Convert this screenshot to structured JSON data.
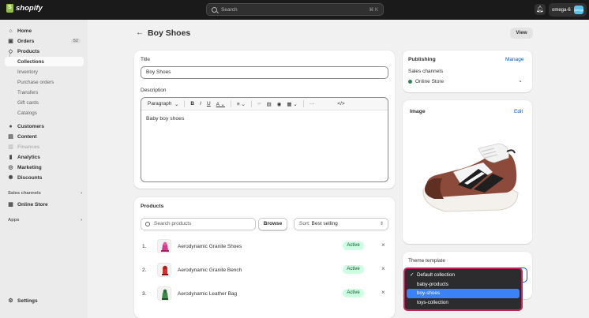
{
  "topbar": {
    "brand": "shopify",
    "search_placeholder": "Search",
    "search_shortcut": "⌘ K",
    "store_name": "omega-6",
    "store_avatar": "omega"
  },
  "sidebar": {
    "items": [
      {
        "label": "Home",
        "icon": "home-icon"
      },
      {
        "label": "Orders",
        "icon": "inbox-icon",
        "badge": "52"
      },
      {
        "label": "Products",
        "icon": "tag-icon"
      }
    ],
    "product_sub": [
      "Collections",
      "Inventory",
      "Purchase orders",
      "Transfers",
      "Gift cards",
      "Catalogs"
    ],
    "items2": [
      {
        "label": "Customers",
        "icon": "person-icon"
      },
      {
        "label": "Content",
        "icon": "content-icon"
      },
      {
        "label": "Finances",
        "icon": "bank-icon",
        "disabled": true
      },
      {
        "label": "Analytics",
        "icon": "chart-icon"
      },
      {
        "label": "Marketing",
        "icon": "target-icon"
      },
      {
        "label": "Discounts",
        "icon": "discount-icon"
      }
    ],
    "sales_channels_heading": "Sales channels",
    "online_store": "Online Store",
    "apps_heading": "Apps",
    "settings": "Settings"
  },
  "page": {
    "title": "Boy Shoes",
    "view_label": "View"
  },
  "details": {
    "title_label": "Title",
    "title_value": "Boy Shoes",
    "description_label": "Description",
    "paragraph_label": "Paragraph",
    "description_text": "Baby boy shoes"
  },
  "products": {
    "heading": "Products",
    "search_placeholder": "Search products",
    "browse_label": "Browse",
    "sort_prefix": "Sort:",
    "sort_value": "Best selling",
    "rows": [
      {
        "num": "1.",
        "name": "Aerodynamic Granite Shoes",
        "status": "Active"
      },
      {
        "num": "2.",
        "name": "Aerodynamic Granite Bench",
        "status": "Active"
      },
      {
        "num": "3.",
        "name": "Aerodynamic Leather Bag",
        "status": "Active"
      }
    ]
  },
  "publishing": {
    "heading": "Publishing",
    "manage_label": "Manage",
    "sales_channels_label": "Sales channels",
    "channel": "Online Store"
  },
  "image_card": {
    "heading": "Image",
    "edit_label": "Edit"
  },
  "theme": {
    "label": "Theme template",
    "options": [
      "Default collection",
      "baby-products",
      "boy-shoes",
      "toys-collection"
    ],
    "checked": "Default collection",
    "highlighted": "boy-shoes"
  },
  "colors": {
    "accent": "#005bd3",
    "active_badge": "#cdfee1",
    "dropdown_highlight": "#3b82f6",
    "dropdown_border": "#c4245a"
  }
}
